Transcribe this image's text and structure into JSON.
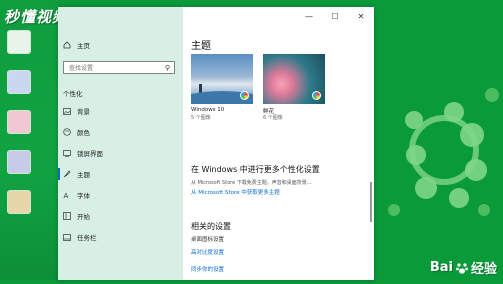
{
  "watermark": "秒懂视频",
  "window": {
    "controls": {
      "minimize": "—",
      "maximize": "☐",
      "close": "✕"
    }
  },
  "sidebar": {
    "home_label": "主页",
    "search_placeholder": "查找设置",
    "section_title": "个性化",
    "items": [
      {
        "label": "背景",
        "icon": "image-icon"
      },
      {
        "label": "颜色",
        "icon": "palette-icon"
      },
      {
        "label": "锁屏界面",
        "icon": "lock-screen-icon"
      },
      {
        "label": "主题",
        "icon": "brush-icon",
        "active": true
      },
      {
        "label": "字体",
        "icon": "font-icon"
      },
      {
        "label": "开始",
        "icon": "start-icon"
      },
      {
        "label": "任务栏",
        "icon": "taskbar-icon"
      }
    ]
  },
  "content": {
    "title": "主题",
    "themes": [
      {
        "name": "Windows 10",
        "count": "5 个图像"
      },
      {
        "name": "鲜花",
        "count": "6 个图像"
      }
    ],
    "more_title": "在 Windows 中进行更多个性化设置",
    "more_desc": "从 Microsoft Store 下载免费主题，声音和桌面背景…",
    "more_link": "从 Microsoft Store 中获取更多主题",
    "related_title": "相关的设置",
    "related_sub": "桌面图标设置",
    "related_links": [
      "高对比度设置",
      "同步你的设置"
    ]
  },
  "brand": {
    "logo": "Bai",
    "logo_rest": "经验"
  },
  "colors": {
    "desktop_green": "#0a9a3a",
    "sidebar_bg": "#d8efe6",
    "accent_blue": "#0b6bd1"
  }
}
